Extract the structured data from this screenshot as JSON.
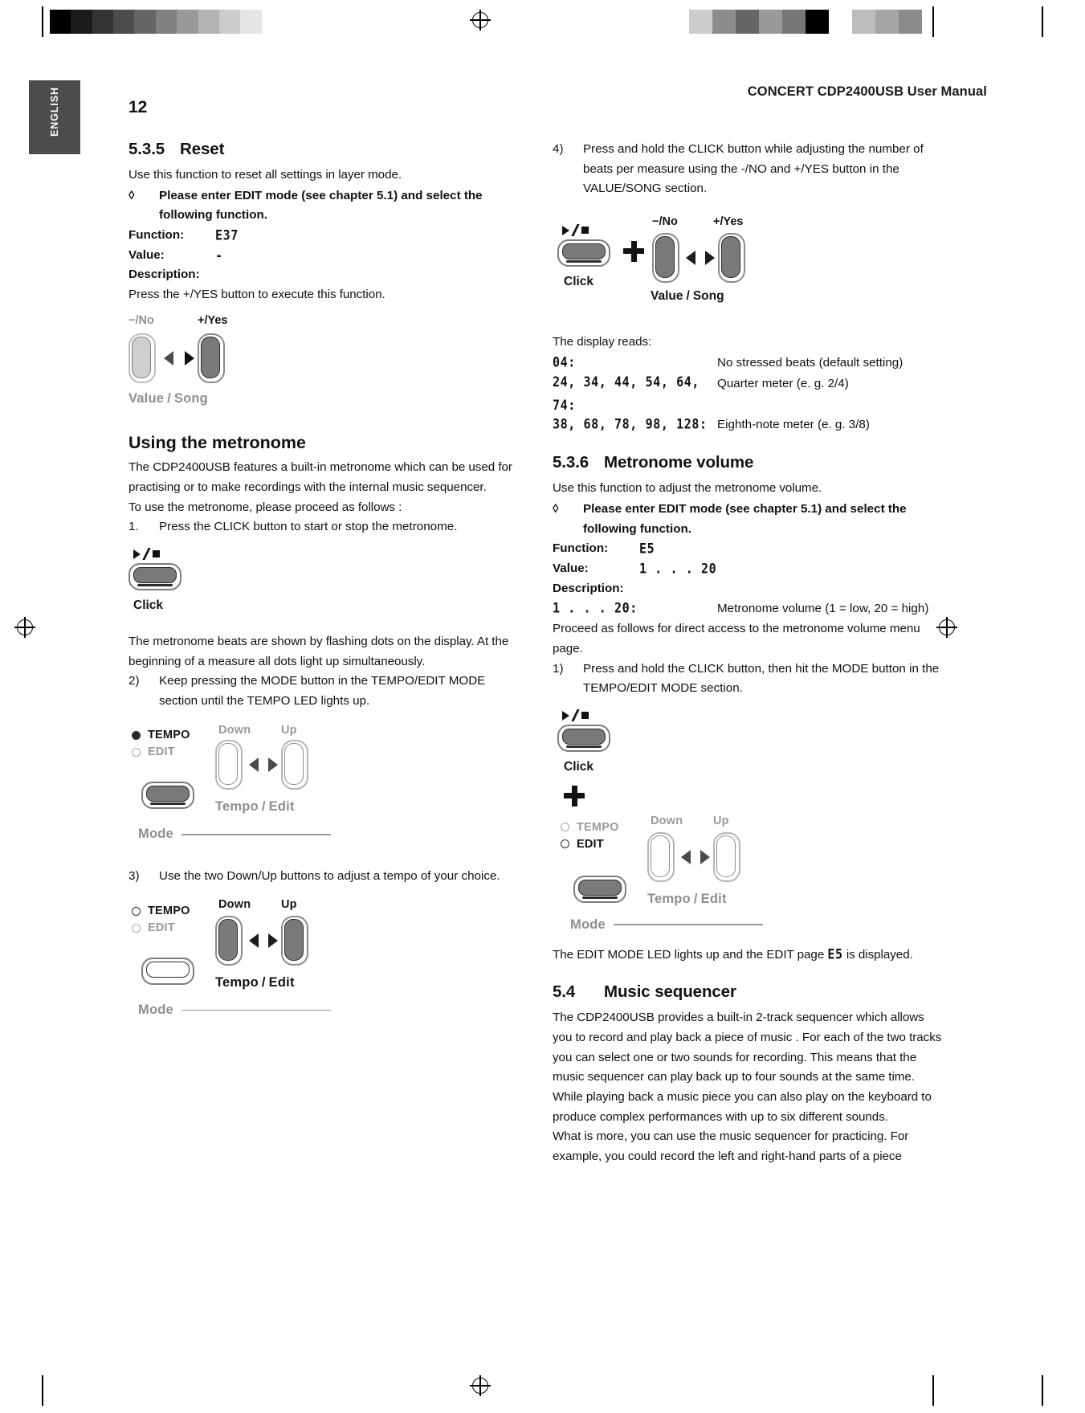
{
  "meta": {
    "language_tab": "ENGLISH",
    "running_head": "CONCERT CDP2400USB User Manual",
    "page_number": "12"
  },
  "left_column": {
    "section_535": {
      "number": "5.3.5",
      "title": "Reset",
      "intro": "Use this function to reset all settings in layer mode.",
      "bullet_glyph": "◊",
      "bullet_text": "Please enter EDIT mode (see chapter 5.1) and select the following function.",
      "function_label": "Function:",
      "function_value": "E37",
      "value_label": "Value:",
      "value_value": "-",
      "description_label": "Description:",
      "description_text": "Press the +/YES button to execute this function."
    },
    "diagram_value_song": {
      "label_no": "−/No",
      "label_yes": "+/Yes",
      "caption": "Value / Song",
      "caption_part1": "Value",
      "caption_sep": "/",
      "caption_part2": "Song"
    },
    "metronome": {
      "heading": "Using the metronome",
      "para1": "The CDP2400USB features a built-in metronome which can be used for practising or to make recordings with the internal music sequencer.",
      "para2": "To use the metronome, please proceed as follows :",
      "step1_num": "1.",
      "step1_text": "Press the CLICK button to start or stop the metronome.",
      "click_caption": "Click",
      "para3": "The metronome beats are shown by flashing dots on the display. At the beginning of a measure all dots light up simultaneously.",
      "step2_num": "2)",
      "step2_text": "Keep pressing the MODE button in the TEMPO/EDIT MODE section until the TEMPO LED lights up.",
      "step3_num": "3)",
      "step3_text": "Use the two Down/Up buttons to adjust a tempo of your choice."
    },
    "diagram_tempo_edit": {
      "led_tempo": "TEMPO",
      "led_edit": "EDIT",
      "label_down": "Down",
      "label_up": "Up",
      "caption_tempo": "Tempo",
      "caption_sep": "/",
      "caption_edit": "Edit",
      "caption_mode": "Mode"
    }
  },
  "right_column": {
    "step4_num": "4)",
    "step4_text": "Press and hold the CLICK button while adjusting the number of beats per measure using the -/NO and +/YES button in the VALUE/SONG section.",
    "diagram_click_value": {
      "click_caption": "Click",
      "label_no": "−/No",
      "label_yes": "+/Yes",
      "value_caption_part1": "Value",
      "value_caption_sep": "/",
      "value_caption_part2": "Song"
    },
    "display_reads_label": "The display reads:",
    "display_rows": [
      {
        "code": "04:",
        "meaning": "No stressed beats (default setting)"
      },
      {
        "code": "24, 34, 44, 54, 64, 74:",
        "meaning": "Quarter meter (e. g. 2/4)"
      },
      {
        "code": "38, 68, 78, 98, 128:",
        "meaning": "Eighth-note meter (e. g. 3/8)"
      }
    ],
    "section_536": {
      "number": "5.3.6",
      "title": "Metronome volume",
      "intro": "Use this function to adjust the metronome volume.",
      "bullet_glyph": "◊",
      "bullet_text": "Please enter EDIT mode (see chapter 5.1) and select the following function.",
      "function_label": "Function:",
      "function_value": "E5",
      "value_label": "Value:",
      "value_value": "1 . . . 20",
      "description_label": "Description:",
      "desc_code": "1 . . . 20:",
      "desc_meaning": "Metronome volume (1 = low, 20 = high)",
      "proceed_text": "Proceed as follows for direct access to the metronome volume menu page.",
      "step1_num": "1)",
      "step1_text": "Press and hold the CLICK button, then hit the MODE button in the TEMPO/EDIT MODE section."
    },
    "diagram_click_mode": {
      "click_caption": "Click",
      "led_tempo": "TEMPO",
      "led_edit": "EDIT",
      "label_down": "Down",
      "label_up": "Up",
      "caption_tempo": "Tempo",
      "caption_sep": "/",
      "caption_edit": "Edit",
      "caption_mode": "Mode"
    },
    "edit_led_text_a": "The EDIT MODE LED lights up and the EDIT page ",
    "edit_led_code": "E5",
    "edit_led_text_b": " is displayed.",
    "section_54": {
      "number": "5.4",
      "title": "Music sequencer",
      "para1": "The CDP2400USB provides a built-in 2-track sequencer which allows you to record and play back a piece of music . For each of the two tracks you can select one or two sounds for recording. This means that the music sequencer can play back up to four sounds at the same time. While playing back a music piece you can also play on the keyboard to produce complex performances with up to six different sounds.",
      "para2": "What is more, you can use the music sequencer for practicing. For example, you could record the left and right-hand parts of a piece"
    }
  },
  "print_marks": {
    "colorbar_left": [
      "#000000",
      "#1a1a1a",
      "#333333",
      "#4d4d4d",
      "#666666",
      "#808080",
      "#999999",
      "#b3b3b3",
      "#cccccc",
      "#e6e6e6",
      "#ffffff"
    ],
    "colorbar_right": [
      "#cccccc",
      "#8c8c8c",
      "#666666",
      "#999999",
      "#777777",
      "#000000",
      "#ffffff",
      "#bdbdbd",
      "#a6a6a6",
      "#8c8c8c"
    ]
  }
}
